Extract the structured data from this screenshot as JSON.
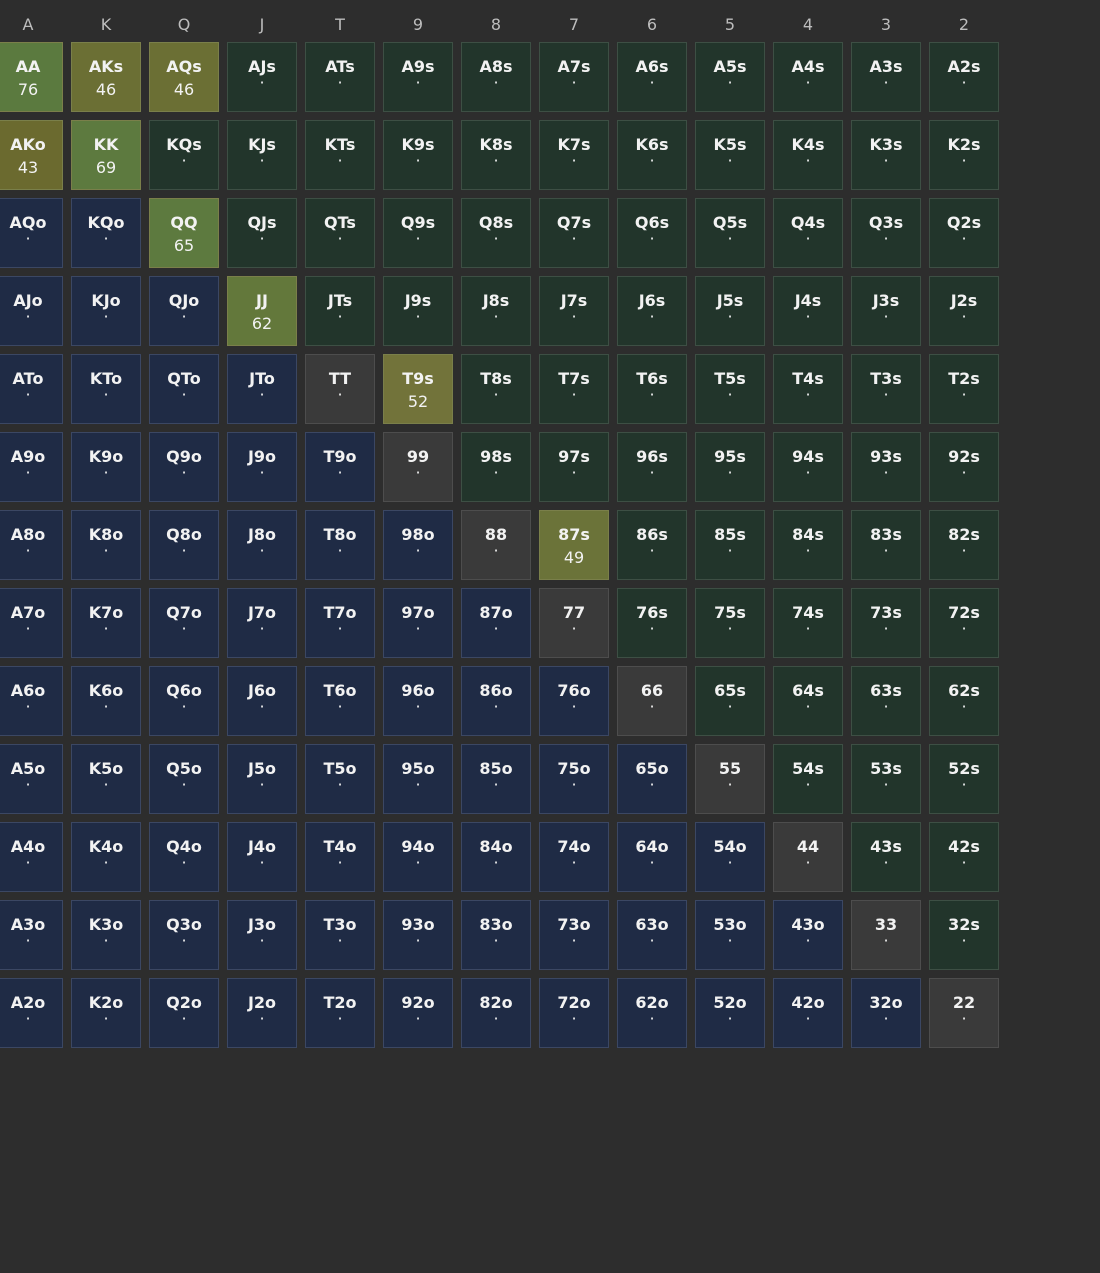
{
  "ranks": [
    "A",
    "K",
    "Q",
    "J",
    "T",
    "9",
    "8",
    "7",
    "6",
    "5",
    "4",
    "3",
    "2"
  ],
  "colors": {
    "suited": "#22352b",
    "offsuit": "#1f2b45",
    "pair": "#3a3a3a",
    "highlights": {
      "AA": "#5b7a3f",
      "AKs": "#6b6f34",
      "AQs": "#6b6f34",
      "AKo": "#6b6a2f",
      "KK": "#5d7a3f",
      "QQ": "#5d7a3f",
      "JJ": "#63783b",
      "T9s": "#72733a",
      "87s": "#6b7339"
    }
  },
  "grid": [
    [
      {
        "hand": "AA",
        "value": "76"
      },
      {
        "hand": "AKs",
        "value": "46"
      },
      {
        "hand": "AQs",
        "value": "46"
      },
      {
        "hand": "AJs",
        "value": "·"
      },
      {
        "hand": "ATs",
        "value": "·"
      },
      {
        "hand": "A9s",
        "value": "·"
      },
      {
        "hand": "A8s",
        "value": "·"
      },
      {
        "hand": "A7s",
        "value": "·"
      },
      {
        "hand": "A6s",
        "value": "·"
      },
      {
        "hand": "A5s",
        "value": "·"
      },
      {
        "hand": "A4s",
        "value": "·"
      },
      {
        "hand": "A3s",
        "value": "·"
      },
      {
        "hand": "A2s",
        "value": "·"
      }
    ],
    [
      {
        "hand": "AKo",
        "value": "43"
      },
      {
        "hand": "KK",
        "value": "69"
      },
      {
        "hand": "KQs",
        "value": "·"
      },
      {
        "hand": "KJs",
        "value": "·"
      },
      {
        "hand": "KTs",
        "value": "·"
      },
      {
        "hand": "K9s",
        "value": "·"
      },
      {
        "hand": "K8s",
        "value": "·"
      },
      {
        "hand": "K7s",
        "value": "·"
      },
      {
        "hand": "K6s",
        "value": "·"
      },
      {
        "hand": "K5s",
        "value": "·"
      },
      {
        "hand": "K4s",
        "value": "·"
      },
      {
        "hand": "K3s",
        "value": "·"
      },
      {
        "hand": "K2s",
        "value": "·"
      }
    ],
    [
      {
        "hand": "AQo",
        "value": "·"
      },
      {
        "hand": "KQo",
        "value": "·"
      },
      {
        "hand": "QQ",
        "value": "65"
      },
      {
        "hand": "QJs",
        "value": "·"
      },
      {
        "hand": "QTs",
        "value": "·"
      },
      {
        "hand": "Q9s",
        "value": "·"
      },
      {
        "hand": "Q8s",
        "value": "·"
      },
      {
        "hand": "Q7s",
        "value": "·"
      },
      {
        "hand": "Q6s",
        "value": "·"
      },
      {
        "hand": "Q5s",
        "value": "·"
      },
      {
        "hand": "Q4s",
        "value": "·"
      },
      {
        "hand": "Q3s",
        "value": "·"
      },
      {
        "hand": "Q2s",
        "value": "·"
      }
    ],
    [
      {
        "hand": "AJo",
        "value": "·"
      },
      {
        "hand": "KJo",
        "value": "·"
      },
      {
        "hand": "QJo",
        "value": "·"
      },
      {
        "hand": "JJ",
        "value": "62"
      },
      {
        "hand": "JTs",
        "value": "·"
      },
      {
        "hand": "J9s",
        "value": "·"
      },
      {
        "hand": "J8s",
        "value": "·"
      },
      {
        "hand": "J7s",
        "value": "·"
      },
      {
        "hand": "J6s",
        "value": "·"
      },
      {
        "hand": "J5s",
        "value": "·"
      },
      {
        "hand": "J4s",
        "value": "·"
      },
      {
        "hand": "J3s",
        "value": "·"
      },
      {
        "hand": "J2s",
        "value": "·"
      }
    ],
    [
      {
        "hand": "ATo",
        "value": "·"
      },
      {
        "hand": "KTo",
        "value": "·"
      },
      {
        "hand": "QTo",
        "value": "·"
      },
      {
        "hand": "JTo",
        "value": "·"
      },
      {
        "hand": "TT",
        "value": "·"
      },
      {
        "hand": "T9s",
        "value": "52"
      },
      {
        "hand": "T8s",
        "value": "·"
      },
      {
        "hand": "T7s",
        "value": "·"
      },
      {
        "hand": "T6s",
        "value": "·"
      },
      {
        "hand": "T5s",
        "value": "·"
      },
      {
        "hand": "T4s",
        "value": "·"
      },
      {
        "hand": "T3s",
        "value": "·"
      },
      {
        "hand": "T2s",
        "value": "·"
      }
    ],
    [
      {
        "hand": "A9o",
        "value": "·"
      },
      {
        "hand": "K9o",
        "value": "·"
      },
      {
        "hand": "Q9o",
        "value": "·"
      },
      {
        "hand": "J9o",
        "value": "·"
      },
      {
        "hand": "T9o",
        "value": "·"
      },
      {
        "hand": "99",
        "value": "·"
      },
      {
        "hand": "98s",
        "value": "·"
      },
      {
        "hand": "97s",
        "value": "·"
      },
      {
        "hand": "96s",
        "value": "·"
      },
      {
        "hand": "95s",
        "value": "·"
      },
      {
        "hand": "94s",
        "value": "·"
      },
      {
        "hand": "93s",
        "value": "·"
      },
      {
        "hand": "92s",
        "value": "·"
      }
    ],
    [
      {
        "hand": "A8o",
        "value": "·"
      },
      {
        "hand": "K8o",
        "value": "·"
      },
      {
        "hand": "Q8o",
        "value": "·"
      },
      {
        "hand": "J8o",
        "value": "·"
      },
      {
        "hand": "T8o",
        "value": "·"
      },
      {
        "hand": "98o",
        "value": "·"
      },
      {
        "hand": "88",
        "value": "·"
      },
      {
        "hand": "87s",
        "value": "49"
      },
      {
        "hand": "86s",
        "value": "·"
      },
      {
        "hand": "85s",
        "value": "·"
      },
      {
        "hand": "84s",
        "value": "·"
      },
      {
        "hand": "83s",
        "value": "·"
      },
      {
        "hand": "82s",
        "value": "·"
      }
    ],
    [
      {
        "hand": "A7o",
        "value": "·"
      },
      {
        "hand": "K7o",
        "value": "·"
      },
      {
        "hand": "Q7o",
        "value": "·"
      },
      {
        "hand": "J7o",
        "value": "·"
      },
      {
        "hand": "T7o",
        "value": "·"
      },
      {
        "hand": "97o",
        "value": "·"
      },
      {
        "hand": "87o",
        "value": "·"
      },
      {
        "hand": "77",
        "value": "·"
      },
      {
        "hand": "76s",
        "value": "·"
      },
      {
        "hand": "75s",
        "value": "·"
      },
      {
        "hand": "74s",
        "value": "·"
      },
      {
        "hand": "73s",
        "value": "·"
      },
      {
        "hand": "72s",
        "value": "·"
      }
    ],
    [
      {
        "hand": "A6o",
        "value": "·"
      },
      {
        "hand": "K6o",
        "value": "·"
      },
      {
        "hand": "Q6o",
        "value": "·"
      },
      {
        "hand": "J6o",
        "value": "·"
      },
      {
        "hand": "T6o",
        "value": "·"
      },
      {
        "hand": "96o",
        "value": "·"
      },
      {
        "hand": "86o",
        "value": "·"
      },
      {
        "hand": "76o",
        "value": "·"
      },
      {
        "hand": "66",
        "value": "·"
      },
      {
        "hand": "65s",
        "value": "·"
      },
      {
        "hand": "64s",
        "value": "·"
      },
      {
        "hand": "63s",
        "value": "·"
      },
      {
        "hand": "62s",
        "value": "·"
      }
    ],
    [
      {
        "hand": "A5o",
        "value": "·"
      },
      {
        "hand": "K5o",
        "value": "·"
      },
      {
        "hand": "Q5o",
        "value": "·"
      },
      {
        "hand": "J5o",
        "value": "·"
      },
      {
        "hand": "T5o",
        "value": "·"
      },
      {
        "hand": "95o",
        "value": "·"
      },
      {
        "hand": "85o",
        "value": "·"
      },
      {
        "hand": "75o",
        "value": "·"
      },
      {
        "hand": "65o",
        "value": "·"
      },
      {
        "hand": "55",
        "value": "·"
      },
      {
        "hand": "54s",
        "value": "·"
      },
      {
        "hand": "53s",
        "value": "·"
      },
      {
        "hand": "52s",
        "value": "·"
      }
    ],
    [
      {
        "hand": "A4o",
        "value": "·"
      },
      {
        "hand": "K4o",
        "value": "·"
      },
      {
        "hand": "Q4o",
        "value": "·"
      },
      {
        "hand": "J4o",
        "value": "·"
      },
      {
        "hand": "T4o",
        "value": "·"
      },
      {
        "hand": "94o",
        "value": "·"
      },
      {
        "hand": "84o",
        "value": "·"
      },
      {
        "hand": "74o",
        "value": "·"
      },
      {
        "hand": "64o",
        "value": "·"
      },
      {
        "hand": "54o",
        "value": "·"
      },
      {
        "hand": "44",
        "value": "·"
      },
      {
        "hand": "43s",
        "value": "·"
      },
      {
        "hand": "42s",
        "value": "·"
      }
    ],
    [
      {
        "hand": "A3o",
        "value": "·"
      },
      {
        "hand": "K3o",
        "value": "·"
      },
      {
        "hand": "Q3o",
        "value": "·"
      },
      {
        "hand": "J3o",
        "value": "·"
      },
      {
        "hand": "T3o",
        "value": "·"
      },
      {
        "hand": "93o",
        "value": "·"
      },
      {
        "hand": "83o",
        "value": "·"
      },
      {
        "hand": "73o",
        "value": "·"
      },
      {
        "hand": "63o",
        "value": "·"
      },
      {
        "hand": "53o",
        "value": "·"
      },
      {
        "hand": "43o",
        "value": "·"
      },
      {
        "hand": "33",
        "value": "·"
      },
      {
        "hand": "32s",
        "value": "·"
      }
    ],
    [
      {
        "hand": "A2o",
        "value": "·"
      },
      {
        "hand": "K2o",
        "value": "·"
      },
      {
        "hand": "Q2o",
        "value": "·"
      },
      {
        "hand": "J2o",
        "value": "·"
      },
      {
        "hand": "T2o",
        "value": "·"
      },
      {
        "hand": "92o",
        "value": "·"
      },
      {
        "hand": "82o",
        "value": "·"
      },
      {
        "hand": "72o",
        "value": "·"
      },
      {
        "hand": "62o",
        "value": "·"
      },
      {
        "hand": "52o",
        "value": "·"
      },
      {
        "hand": "42o",
        "value": "·"
      },
      {
        "hand": "32o",
        "value": "·"
      },
      {
        "hand": "22",
        "value": "·"
      }
    ]
  ]
}
